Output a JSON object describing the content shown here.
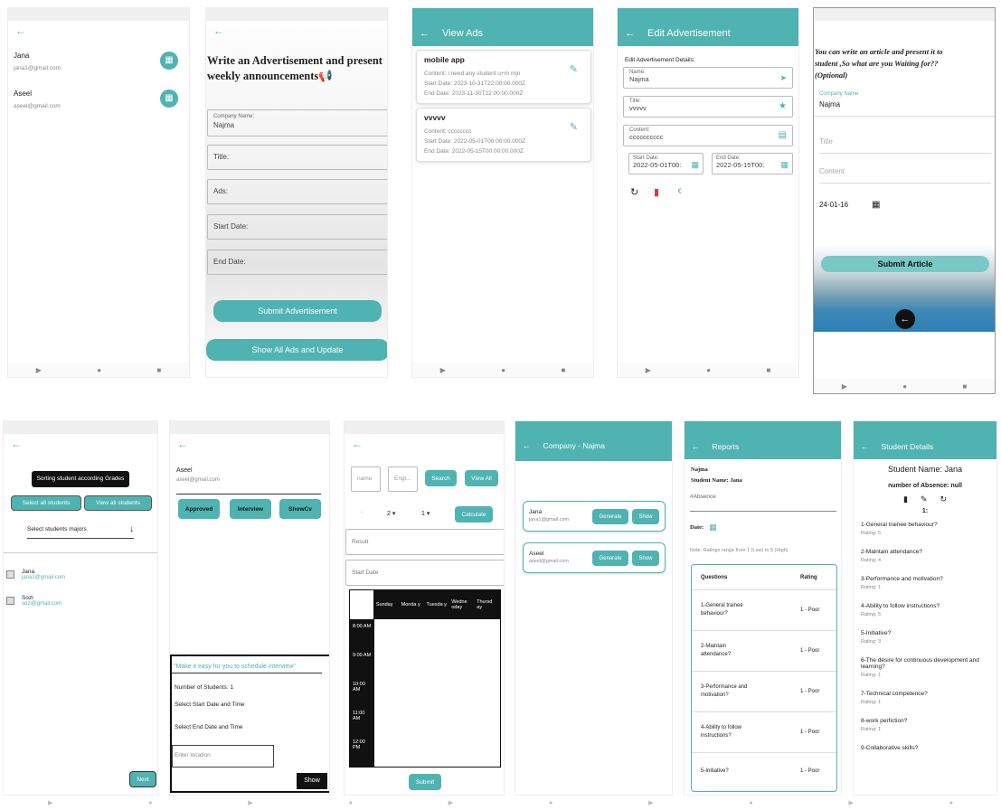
{
  "p1": {
    "users": [
      {
        "name": "Jana",
        "email": "jana1@gmail.com"
      },
      {
        "name": "Aseel",
        "email": "aseel@gmail.com"
      }
    ]
  },
  "p2": {
    "title": "Write an Advertisement and present weekly announcements📢",
    "company_label": "Company Name:",
    "company_value": "Najma",
    "title_label": "Title:",
    "ads_label": "Ads:",
    "start_label": "Start Date:",
    "end_label": "End Date:",
    "submit": "Submit Advertisement",
    "show_all": "Show All Ads and Update"
  },
  "p3": {
    "header": "View Ads",
    "ads": [
      {
        "title": "mobile app",
        "content": "Content: i need any student u+m mjn",
        "start": "Start Date: 2023-10-31T22:00:00.000Z",
        "end": "End Date: 2023-11-30T22:00:00.000Z"
      },
      {
        "title": "vvvvv",
        "content": "Content: cccccccc",
        "start": "Start Date: 2022-05-01T00:00:00.000Z",
        "end": "End Date: 2022-05-15T00:00:00.000Z"
      }
    ]
  },
  "p4": {
    "header": "Edit Advertisement",
    "section": "Edit Advertisement Details:",
    "name_label": "Name:",
    "name_value": "Najma",
    "title_label": "Title:",
    "title_value": "vvvvv",
    "content_label": "Content:",
    "content_value": "cccccccccc",
    "start_label": "Start Date:",
    "start_value": "2022-05-01T00:",
    "end_label": "End Date:",
    "end_value": "2022-05-15T00:"
  },
  "p5": {
    "intro": "You can write an article and present it to student ,So what are you Waiting for??(Optional)",
    "company_label": "Company Name",
    "company_value": "Najma",
    "title_placeholder": "Title",
    "content_placeholder": "Content",
    "date": "24-01-16",
    "submit": "Submit Article"
  },
  "p6": {
    "sort_label": "Sorting student according Grades",
    "select_all": "Select all students",
    "view_all": "View all students",
    "majors": "Select students majors",
    "students": [
      {
        "name": "Jana",
        "email": "jana1@gmail.com"
      },
      {
        "name": "Sozi",
        "email": "sozi@gmail.com"
      }
    ],
    "next": "Next"
  },
  "p7": {
    "name": "Aseel",
    "email": "aseel@gmail.com",
    "approved": "Approved",
    "interview": "Interview",
    "showcv": "ShowCv",
    "quote": "\"Make it easy for you to schedule interview\"",
    "num_students": "Number of Students: 1",
    "start_dt": "Select Start Date and Time",
    "end_dt": "Select End Date and Time",
    "location_placeholder": "Enter location",
    "show": "Show"
  },
  "p8": {
    "name_placeholder": "name",
    "eng_placeholder": "Engi...",
    "search": "Search",
    "view_all": "View All",
    "dd1": "2",
    "dd2": "1",
    "calculate": "Calculate",
    "result_placeholder": "Result",
    "start_placeholder": "Start Date",
    "days": [
      "Sunday",
      "Monda y",
      "Tuesda y",
      "Wedne oday",
      "Thursd ay"
    ],
    "times": [
      "8:00 AM",
      "9:00 AM",
      "10:00 AM",
      "11:00 AM",
      "12:00 PM"
    ],
    "submit": "Submit"
  },
  "p9": {
    "header": "Company - Najma",
    "rows": [
      {
        "name": "Jana",
        "email": "jana1@gmail.com"
      },
      {
        "name": "Aseel",
        "email": "aseel@gmail.com"
      }
    ],
    "generate": "Generate",
    "show": "Show"
  },
  "p10": {
    "header": "Reports",
    "company": "Najma",
    "student": "Student Name: Jana",
    "absence": "#Absence",
    "date_label": "Date:",
    "note": "Note: Ratings range from 1 (Low) to 5 (High)",
    "col_q": "Questions",
    "col_r": "Rating",
    "rows": [
      {
        "q": "1-General trainee behaviour?",
        "r": "1 - Poor"
      },
      {
        "q": "2-Maintain attendance?",
        "r": "1 - Poor"
      },
      {
        "q": "3-Performance and motivation?",
        "r": "1 - Poor"
      },
      {
        "q": "4-Ability to follow instructions?",
        "r": "1 - Poor"
      },
      {
        "q": "5-Initiative?",
        "r": "1 - Poor"
      }
    ]
  },
  "p11": {
    "header": "Student Details",
    "student": "Student Name: Jana",
    "absence": "number of Absence: null",
    "index": "1:",
    "items": [
      {
        "q": "1-General trainee behaviour?",
        "r": "Rating: 5"
      },
      {
        "q": "2-Maintain attendance?",
        "r": "Rating: 4"
      },
      {
        "q": "3-Performance and motivation?",
        "r": "Rating: 1"
      },
      {
        "q": "4-Ability to follow instructions?",
        "r": "Rating: 5"
      },
      {
        "q": "5-Initiative?",
        "r": "Rating: 3"
      },
      {
        "q": "6-The desire for continuous development and learning?",
        "r": "Rating: 1"
      },
      {
        "q": "7-Technical competence?",
        "r": "Rating: 1"
      },
      {
        "q": "8-work perfiction?",
        "r": "Rating: 1"
      },
      {
        "q": "9-Collaborative skills?",
        "r": ""
      }
    ]
  },
  "icons": {
    "back": "←",
    "calendar": "▦",
    "edit": "✎",
    "send": "➤",
    "star": "★",
    "card": "▤",
    "refresh": "↻",
    "trash": "▮",
    "chevron": "‹",
    "play": "▶",
    "circle": "●",
    "square": "■",
    "dropdown": "▾",
    "arrow_down": "↓"
  }
}
